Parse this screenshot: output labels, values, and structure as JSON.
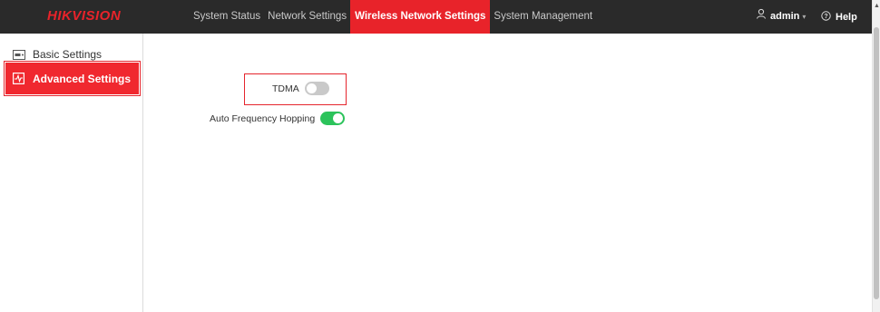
{
  "brand": {
    "logo_text": "HIKVISION",
    "accent_color": "#e8232a"
  },
  "nav": {
    "items": [
      {
        "label": "System Status",
        "active": false
      },
      {
        "label": "Network Settings",
        "active": false
      },
      {
        "label": "Wireless Network Settings",
        "active": true
      },
      {
        "label": "System Management",
        "active": false
      }
    ]
  },
  "user": {
    "name": "admin",
    "icon": "user-icon"
  },
  "help": {
    "label": "Help",
    "icon": "help-circle-icon"
  },
  "sidebar": {
    "items": [
      {
        "label": "Basic Settings",
        "icon": "card-icon",
        "active": false
      },
      {
        "label": "Advanced Settings",
        "icon": "activity-icon",
        "active": true
      }
    ]
  },
  "settings": {
    "tdma": {
      "label": "TDMA",
      "enabled": false
    },
    "auto_frequency_hopping": {
      "label": "Auto Frequency Hopping",
      "enabled": true
    }
  }
}
